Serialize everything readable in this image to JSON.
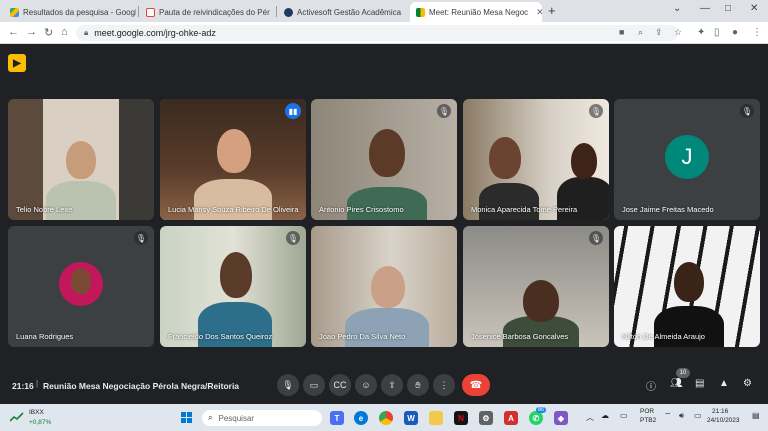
{
  "browser": {
    "tabs": [
      {
        "label": "Resultados da pesquisa - Googl",
        "favicon": "google-drive-icon",
        "active": false
      },
      {
        "label": "Pauta de reivindicações do Pér",
        "favicon": "gmail-icon",
        "active": false
      },
      {
        "label": "Activesoft Gestão Acadêmica",
        "favicon": "activesoft-icon",
        "active": false
      },
      {
        "label": "Meet: Reunião Mesa Negoc",
        "favicon": "meet-icon",
        "active": true
      }
    ],
    "url": "meet.google.com/jrg-ohke-adz"
  },
  "participants": [
    {
      "name": "Telio Nobre Leite",
      "muted": false,
      "speaking": false
    },
    {
      "name": "Lucia Marisy Souza Ribeiro De Oliveira",
      "muted": false,
      "speaking": true
    },
    {
      "name": "Antonio Pires Crisostomo",
      "muted": true,
      "speaking": false
    },
    {
      "name": "Monica Aparecida Tome Pereira",
      "muted": true,
      "speaking": false
    },
    {
      "name": "Jose Jaime Freitas Macedo",
      "muted": true,
      "speaking": false,
      "avatar_letter": "J"
    },
    {
      "name": "Luana Rodrigues",
      "muted": true,
      "speaking": false
    },
    {
      "name": "Francieldo Dos Santos Queiroz",
      "muted": true,
      "speaking": false
    },
    {
      "name": "Joao Pedro Da Silva Neto",
      "muted": false,
      "speaking": false
    },
    {
      "name": "Josenice Barbosa Goncalves",
      "muted": true,
      "speaking": false
    },
    {
      "name": "Nilton De Almeida Araujo",
      "muted": false,
      "speaking": false
    }
  ],
  "meeting": {
    "time": "21:16",
    "title": "Reunião Mesa Negociação Pérola Negra/Reitoria",
    "participant_count": "10"
  },
  "taskbar": {
    "ticker_symbol": "IBXX",
    "ticker_change": "+0,87%",
    "search_placeholder": "Pesquisar",
    "whatsapp_badge": "86",
    "lang_line1": "POR",
    "lang_line2": "PTB2",
    "clock_time": "21:16",
    "clock_date": "24/10/2023"
  },
  "colors": {
    "meet_bg": "#202124",
    "tile_bg": "#3c4043",
    "speaking_outline": "#8ab4f8",
    "hangup": "#ea4335",
    "avatar_teal": "#00897b"
  }
}
